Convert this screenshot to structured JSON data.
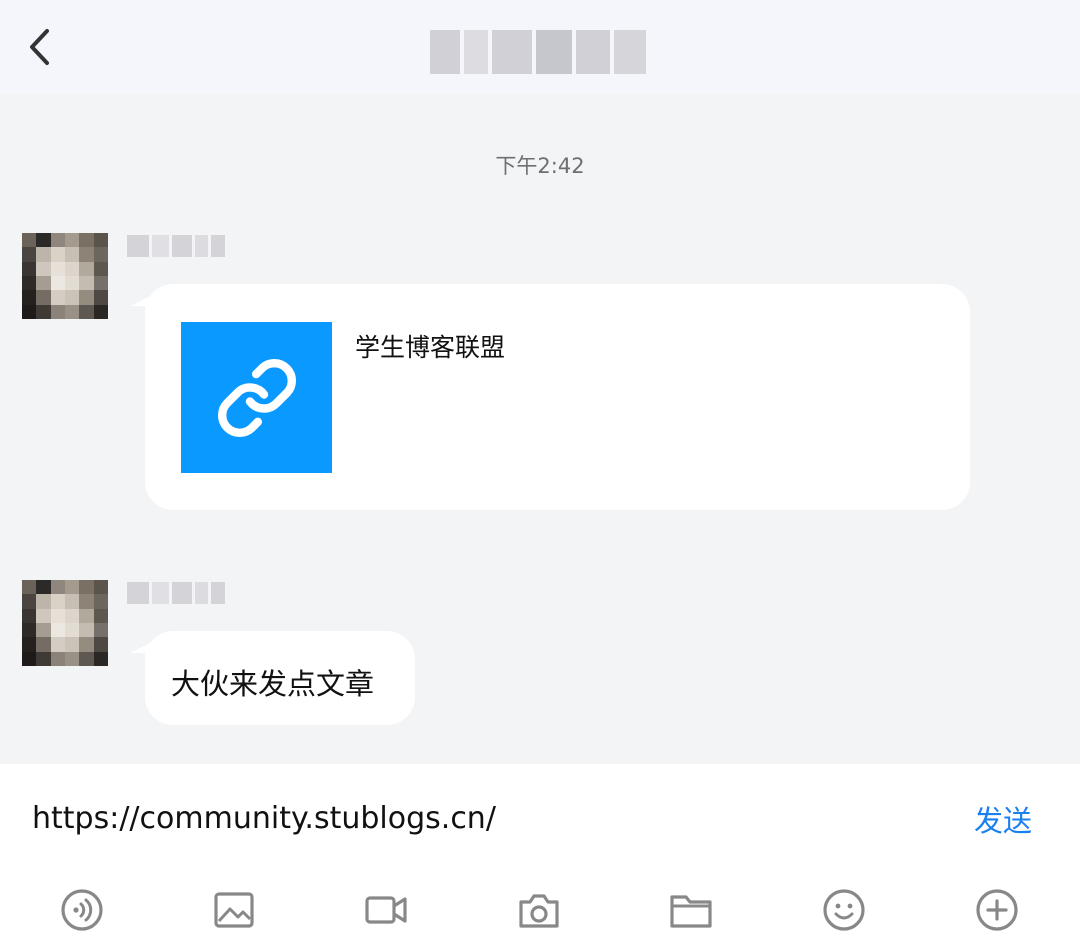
{
  "header": {
    "back_icon": "chevron-left-icon"
  },
  "chat": {
    "timestamp": "下午2:42",
    "messages": [
      {
        "type": "link",
        "title": "学生博客联盟",
        "thumb_icon": "link-icon",
        "thumb_color": "#0a99ff"
      },
      {
        "type": "text",
        "text": "大伙来发点文章"
      }
    ]
  },
  "composer": {
    "input_value": "https://community.stublogs.cn/",
    "send_label": "发送",
    "send_color": "#1a7ff0",
    "tools": [
      "voice-icon",
      "image-icon",
      "video-icon",
      "camera-icon",
      "folder-icon",
      "emoji-icon",
      "plus-circle-icon"
    ]
  }
}
